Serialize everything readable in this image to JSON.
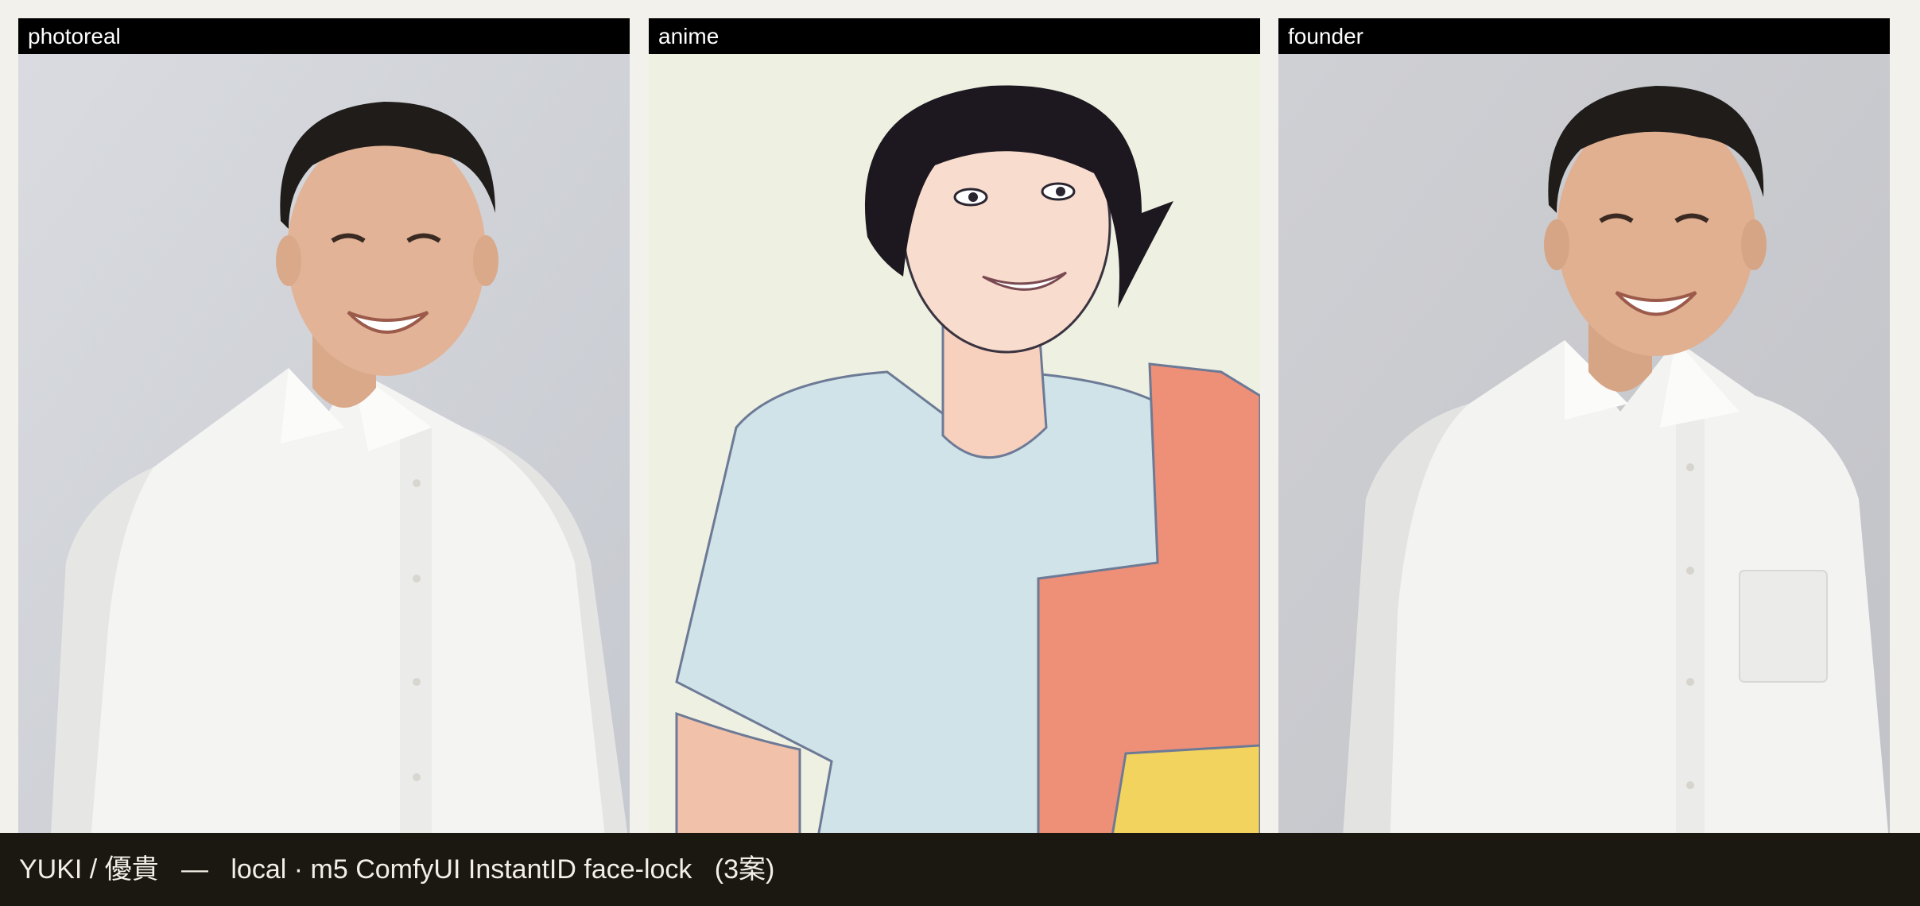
{
  "panels": [
    {
      "label": "photoreal",
      "image": "smiling man in white dress shirt, photorealistic portrait on gray background"
    },
    {
      "label": "anime",
      "image": "illustrated anime-style smiling man in light blue t-shirt with orange bag strap"
    },
    {
      "label": "founder",
      "image": "smiling man in white button-down shirt, founder-style photo on gray background"
    }
  ],
  "caption": "YUKI / 優貴   —   local · m5 ComfyUI InstantID face-lock   (3案)",
  "colors": {
    "page_bg": "#f3f1ec",
    "header_bg": "#000000",
    "header_text": "#ffffff",
    "caption_bg": "#1b1812",
    "caption_text": "#f2efe6"
  }
}
